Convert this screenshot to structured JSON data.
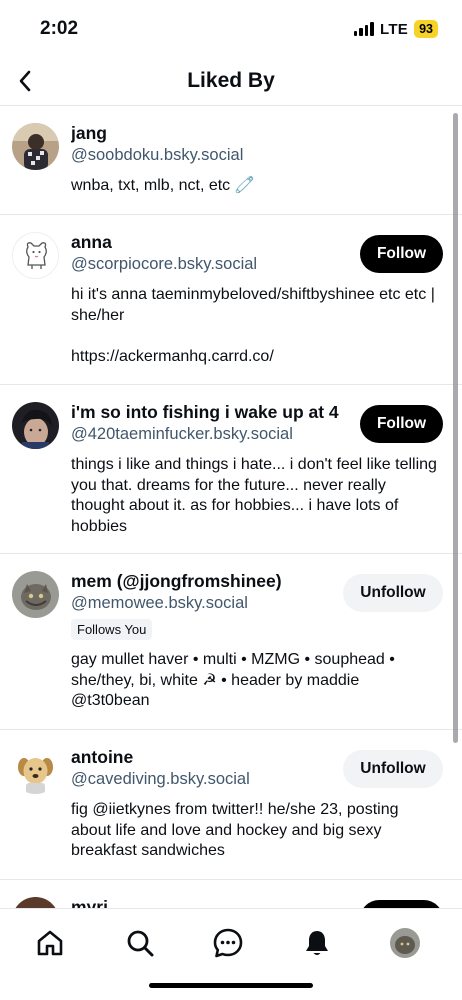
{
  "status_bar": {
    "time": "2:02",
    "network": "LTE",
    "battery": "93"
  },
  "header": {
    "title": "Liked By",
    "back_icon": "chevron-left-icon"
  },
  "users": [
    {
      "name": "jang",
      "handle": "@soobdoku.bsky.social",
      "bio": "wnba, txt, mlb, nct, etc 🧷",
      "button": "",
      "follows_you": ""
    },
    {
      "name": "anna",
      "handle": "@scorpiocore.bsky.social",
      "bio": "hi it's anna taeminmybeloved/shiftbyshinee etc etc | she/her\n\nhttps://ackermanhq.carrd.co/",
      "button": "Follow",
      "follows_you": ""
    },
    {
      "name": "i'm so into fishing i wake up at 4",
      "handle": "@420taeminfucker.bsky.social",
      "bio": "things i like and things i hate... i don't feel like telling you that. dreams for the future... never really thought about it. as for hobbies... i have lots of hobbies",
      "button": "Follow",
      "follows_you": ""
    },
    {
      "name": "mem (@jjongfromshinee)",
      "handle": "@memowee.bsky.social",
      "bio": "gay mullet haver • multi • MZMG • souphead • she/they, bi, white ☭ • header by maddie @t3t0bean",
      "button": "Unfollow",
      "follows_you": "Follows You"
    },
    {
      "name": "antoine",
      "handle": "@cavediving.bsky.social",
      "bio": "fig @iietkynes from twitter!! he/she 23, posting about life and love and hockey and big sexy breakfast sandwiches",
      "button": "Unfollow",
      "follows_you": ""
    },
    {
      "name": "myri",
      "handle": "",
      "bio": "",
      "button": "",
      "follows_you": ""
    }
  ],
  "tabbar": {
    "icons": [
      "home-icon",
      "search-icon",
      "chat-icon",
      "bell-icon",
      "profile-avatar"
    ]
  },
  "colors": {
    "accent": "#000000",
    "handle": "#42576c",
    "divider": "#e5e7eb",
    "battery": "#f7d227"
  }
}
